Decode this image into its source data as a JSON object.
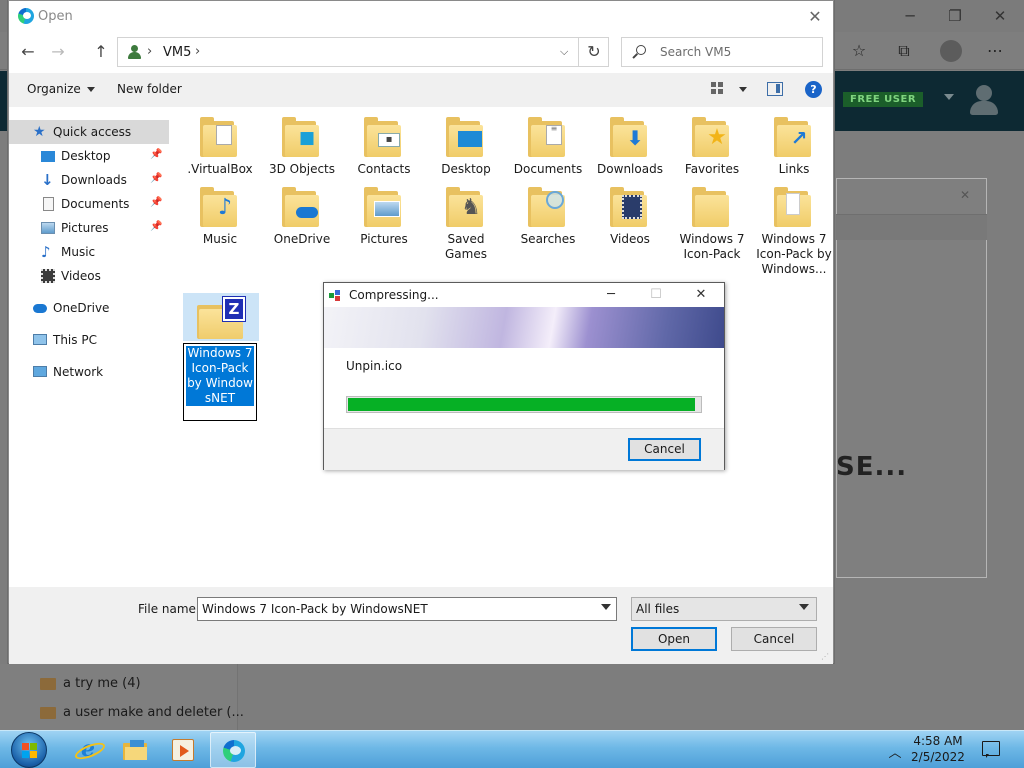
{
  "open_dialog": {
    "title": "Open",
    "address": {
      "path_part": "VM5"
    },
    "search_placeholder": "Search VM5",
    "commands": {
      "organize": "Organize",
      "new_folder": "New folder"
    },
    "nav_pane": [
      {
        "label": "Quick access",
        "icon": "star-icon",
        "pinned": false
      },
      {
        "label": "Desktop",
        "icon": "desktop-icon",
        "pinned": true
      },
      {
        "label": "Downloads",
        "icon": "download-arrow-icon",
        "pinned": true
      },
      {
        "label": "Documents",
        "icon": "document-icon",
        "pinned": true
      },
      {
        "label": "Pictures",
        "icon": "picture-icon",
        "pinned": true
      },
      {
        "label": "Music",
        "icon": "music-note-icon",
        "pinned": false
      },
      {
        "label": "Videos",
        "icon": "film-icon",
        "pinned": false
      },
      {
        "label": "OneDrive",
        "icon": "cloud-icon",
        "pinned": false
      },
      {
        "label": "This PC",
        "icon": "computer-icon",
        "pinned": false
      },
      {
        "label": "Network",
        "icon": "network-icon",
        "pinned": false
      }
    ],
    "files": [
      {
        "name": ".VirtualBox",
        "icon": "document-folder-icon"
      },
      {
        "name": "3D Objects",
        "icon": "cube-folder-icon"
      },
      {
        "name": "Contacts",
        "icon": "contact-card-folder-icon"
      },
      {
        "name": "Desktop",
        "icon": "desktop-folder-icon"
      },
      {
        "name": "Documents",
        "icon": "document-folder-icon"
      },
      {
        "name": "Downloads",
        "icon": "download-folder-icon"
      },
      {
        "name": "Favorites",
        "icon": "star-folder-icon"
      },
      {
        "name": "Links",
        "icon": "link-arrow-folder-icon"
      },
      {
        "name": "Music",
        "icon": "music-folder-icon"
      },
      {
        "name": "OneDrive",
        "icon": "cloud-folder-icon"
      },
      {
        "name": "Pictures",
        "icon": "picture-folder-icon"
      },
      {
        "name": "Saved Games",
        "icon": "chess-piece-folder-icon"
      },
      {
        "name": "Searches",
        "icon": "magnifier-folder-icon"
      },
      {
        "name": "Videos",
        "icon": "film-folder-icon"
      },
      {
        "name": "Windows 7 Icon-Pack",
        "icon": "folder-icon"
      },
      {
        "name": "Windows 7 Icon-Pack by Windows...",
        "icon": "document-folder-icon"
      }
    ],
    "selected_file": {
      "name": "Windows 7 Icon-Pack by WindowsNET",
      "badge": "Z"
    },
    "file_name_label": "File name:",
    "file_name_value": "Windows 7 Icon-Pack by WindowsNET",
    "file_type": "All files",
    "open_button": "Open",
    "cancel_button": "Cancel"
  },
  "compress_dialog": {
    "title": "Compressing...",
    "current_file": "Unpin.ico",
    "progress": 0.985,
    "cancel_button": "Cancel"
  },
  "background": {
    "site_badge": "FREE USER",
    "partial_heading": "SE...",
    "sidebar_items": [
      "a try me (4)",
      "a user make and deleter (..."
    ]
  },
  "taskbar": {
    "time": "4:58 AM",
    "date": "2/5/2022",
    "apps": [
      "internet-explorer-icon",
      "file-explorer-icon",
      "media-player-icon",
      "edge-browser-icon"
    ]
  },
  "colors": {
    "accent": "#0078d7",
    "progress_green": "#06b025",
    "folder_yellow": "#f0cc68",
    "selection": "#cce4f7"
  }
}
